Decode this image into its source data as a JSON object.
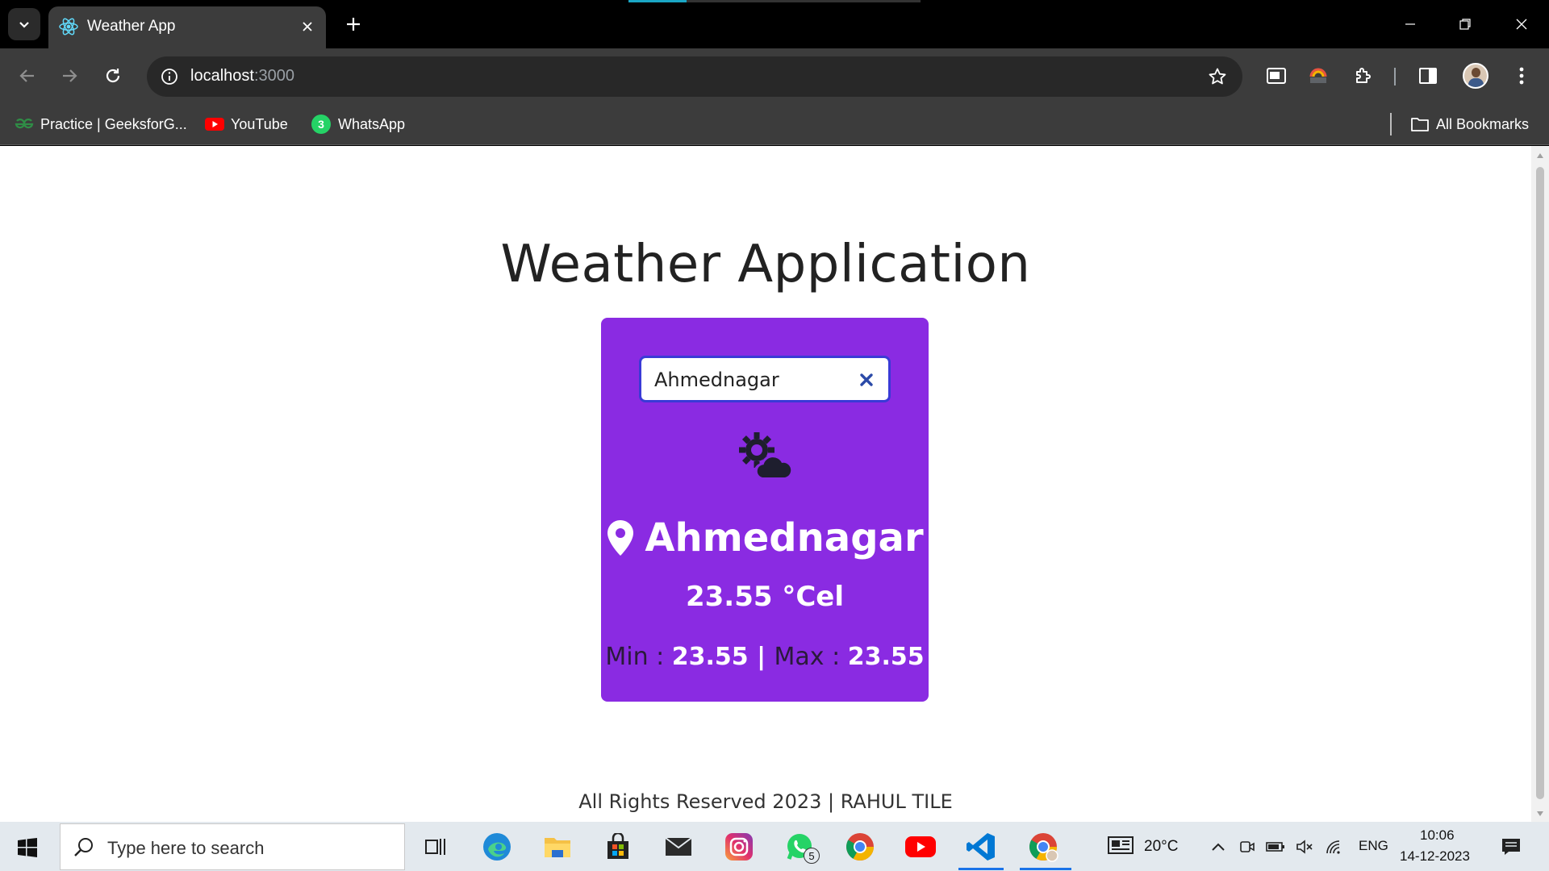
{
  "browser": {
    "tab_title": "Weather App",
    "url_host": "localhost",
    "url_port": ":3000",
    "bookmarks": [
      {
        "label": "Practice | GeeksforG...",
        "icon": "gfg-icon"
      },
      {
        "label": "YouTube",
        "icon": "youtube-icon"
      },
      {
        "label": "WhatsApp",
        "icon": "whatsapp-icon"
      }
    ],
    "all_bookmarks_label": "All Bookmarks"
  },
  "app": {
    "title": "Weather Application",
    "search_value": "Ahmednagar",
    "city": "Ahmednagar",
    "temperature": "23.55 °Cel",
    "min_label": "Min : ",
    "min_value": "23.55",
    "separator": " | ",
    "max_label": "Max : ",
    "max_value": "23.55",
    "footer": "All Rights Reserved 2023 | RAHUL TILE",
    "card_color": "#8a2be2",
    "weather_icon": "sun-cloud-icon"
  },
  "taskbar": {
    "search_placeholder": "Type here to search",
    "weather_temp": "20°C",
    "language": "ENG",
    "time": "10:06",
    "date": "14-12-2023",
    "whatsapp_badge": "5",
    "bookmark_whatsapp_badge": "3"
  }
}
